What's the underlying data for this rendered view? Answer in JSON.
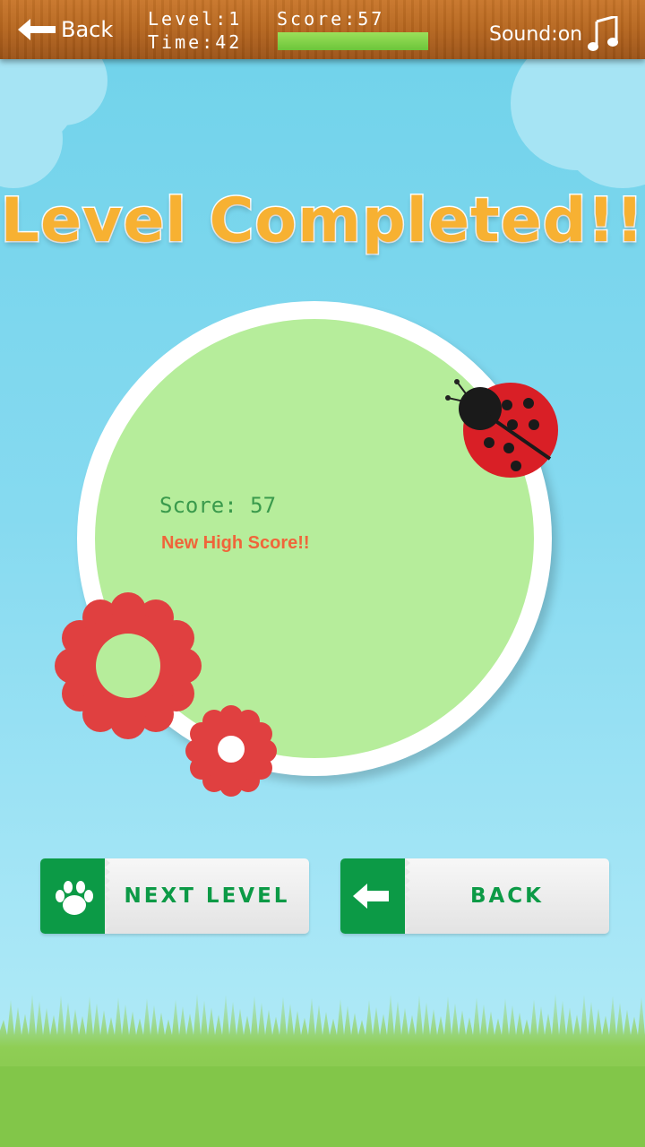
{
  "topbar": {
    "back_label": "Back",
    "level_text": "Level:1",
    "time_text": "Time:42",
    "score_text": "Score:57",
    "score_progress": 1.0,
    "sound_label": "Sound:on",
    "sound_icon": "music-note-icon"
  },
  "main": {
    "title": "Level Completed!!",
    "result_score": "Score: 57",
    "result_message": "New High Score!!"
  },
  "buttons": {
    "next_level_label": "NEXT LEVEL",
    "next_level_icon": "paw-icon",
    "back_label": "BACK",
    "back_icon": "arrow-left-icon"
  },
  "colors": {
    "title": "#f7b132",
    "button_green": "#0c9a46",
    "circle_fill": "#b6ed9b",
    "flower_red": "#e04040",
    "score_text": "#3a9a4c",
    "high_score_text": "#f0653a"
  }
}
